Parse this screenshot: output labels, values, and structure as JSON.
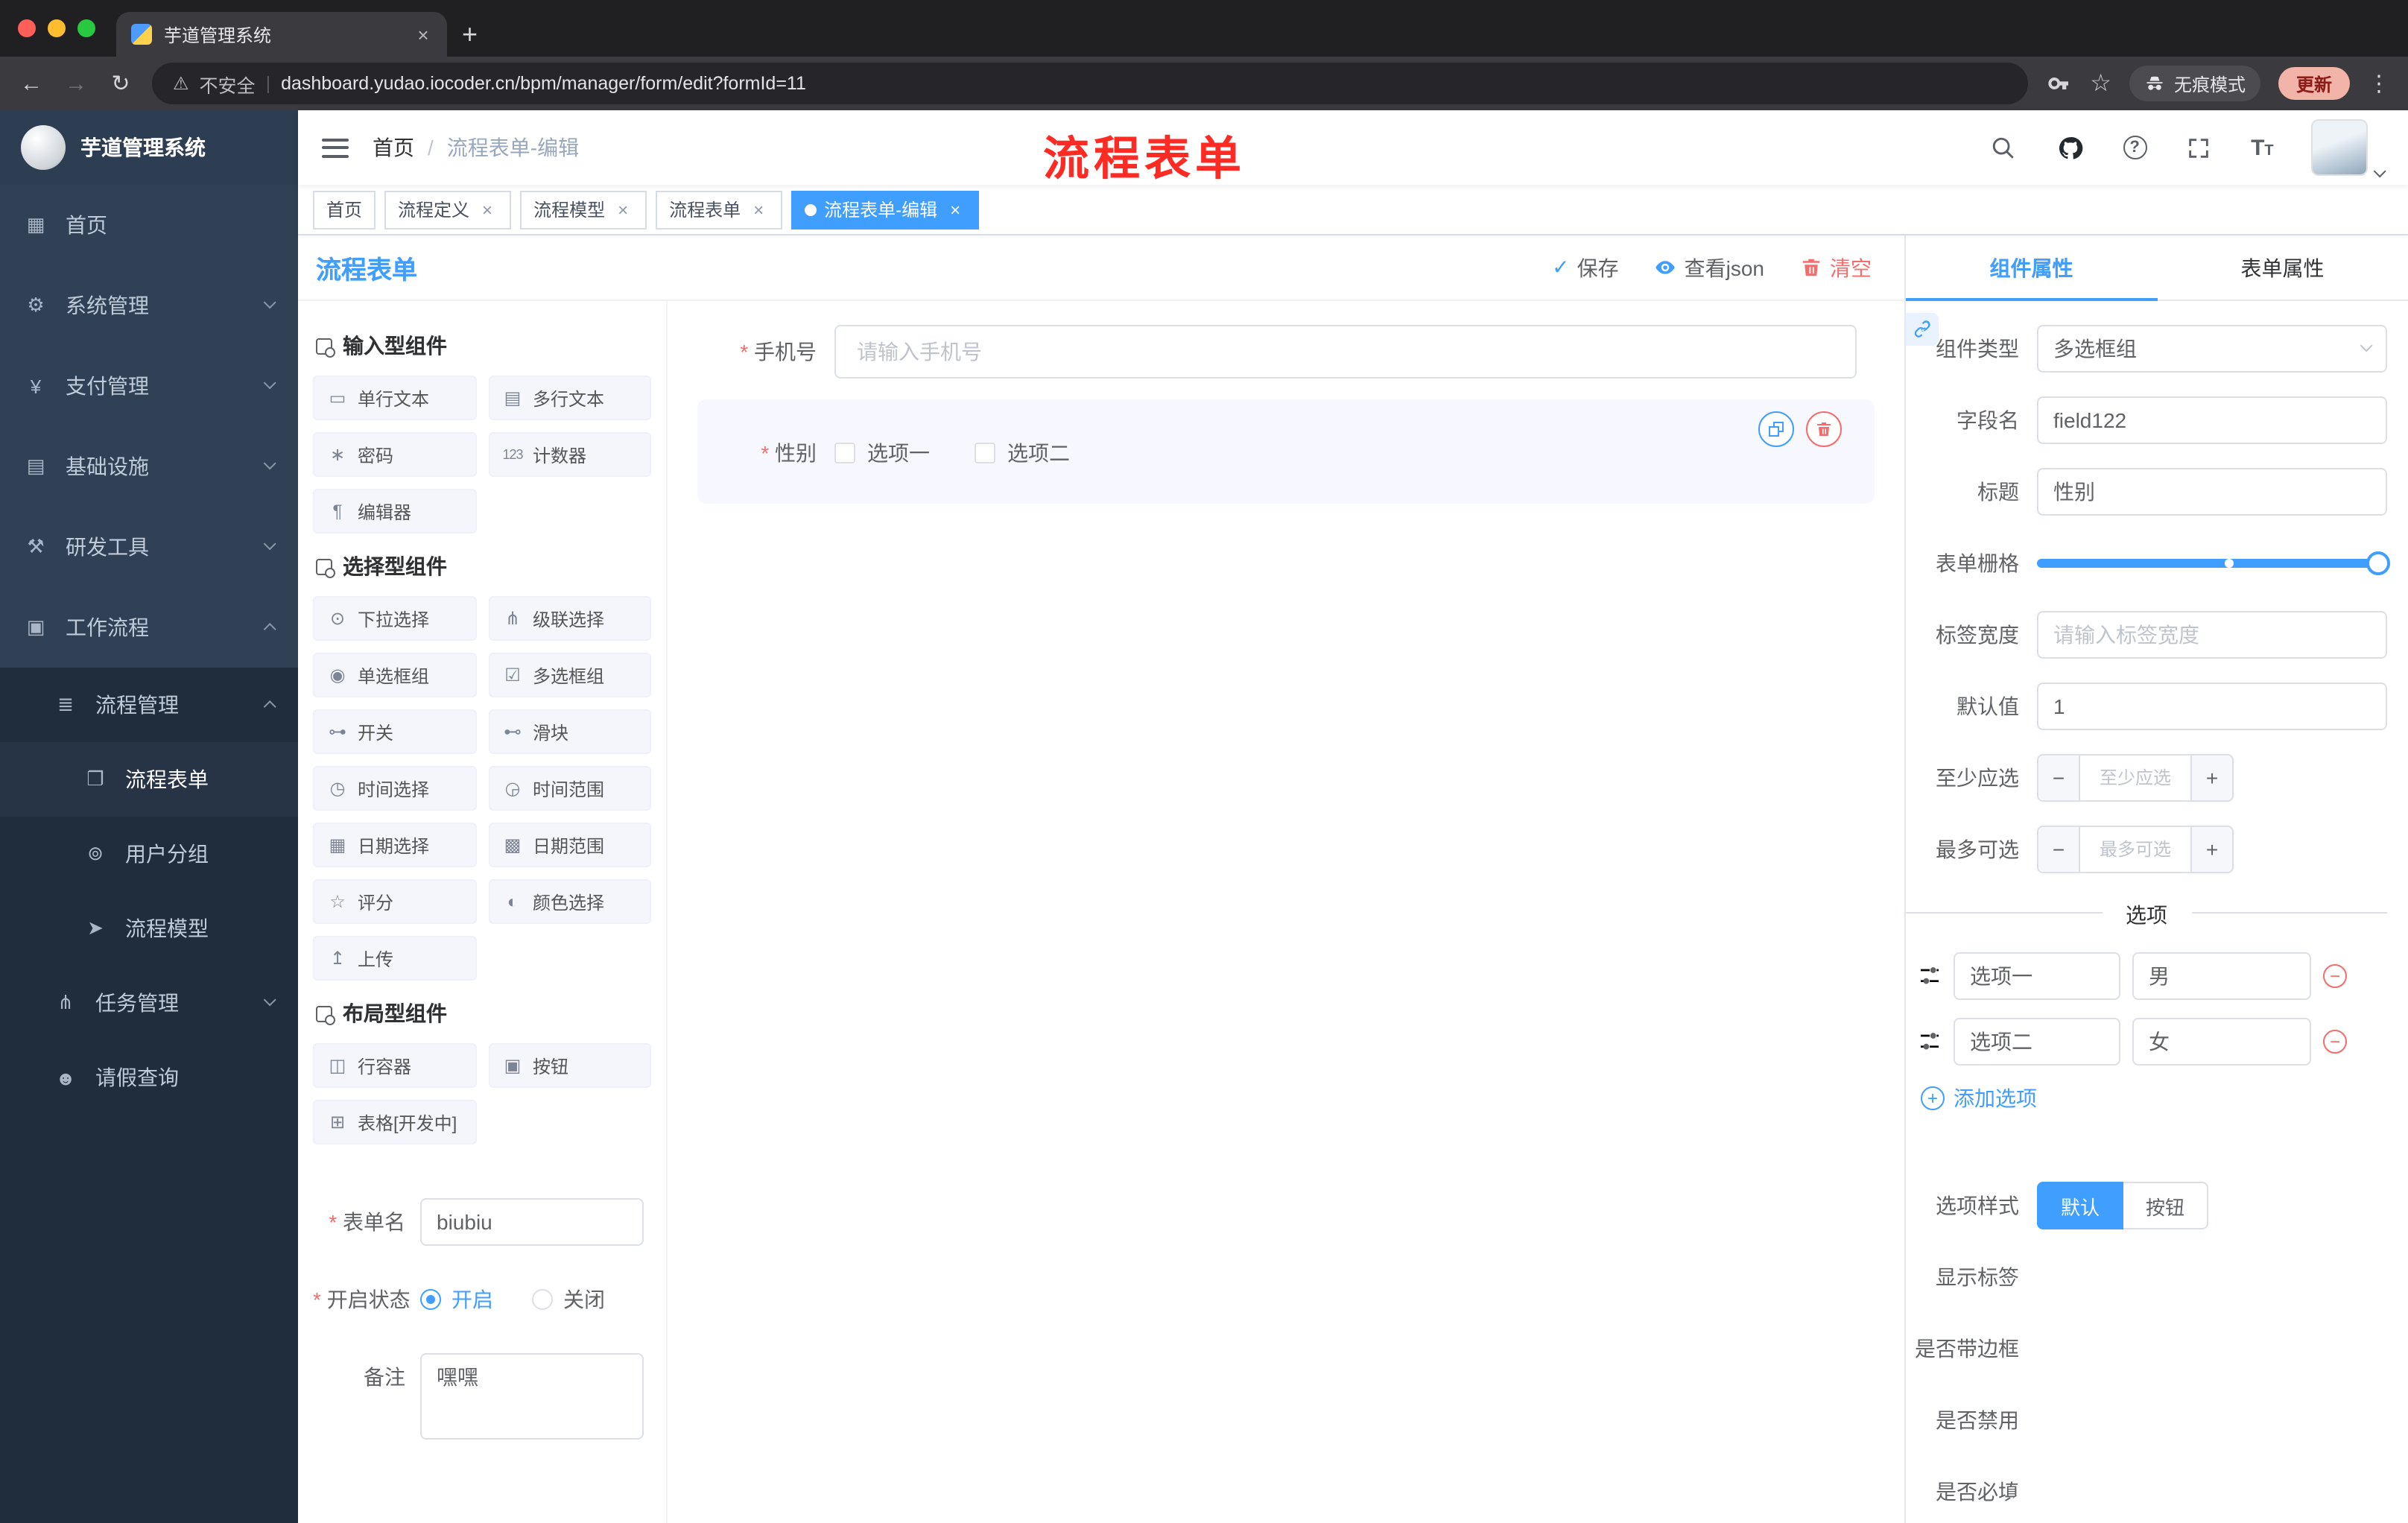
{
  "colors": {
    "primary": "#409eff",
    "danger": "#f56c6c",
    "annotation_red": "#fe2b25",
    "sidebar_bg": "#304156",
    "submenu_bg": "#1f2d3d"
  },
  "browser": {
    "tab_title": "芋道管理系统",
    "new_tab": "+",
    "security_label": "不安全",
    "url": "dashboard.yudao.iocoder.cn/bpm/manager/form/edit?formId=11",
    "incognito_label": "无痕模式",
    "update_label": "更新"
  },
  "sidebar": {
    "logo_title": "芋道管理系统",
    "menu": [
      {
        "label": "首页"
      },
      {
        "label": "系统管理"
      },
      {
        "label": "支付管理"
      },
      {
        "label": "基础设施"
      },
      {
        "label": "研发工具"
      },
      {
        "label": "工作流程"
      }
    ],
    "submenu": {
      "process_mgmt": "流程管理",
      "process_form": "流程表单",
      "user_group": "用户分组",
      "process_model": "流程模型",
      "task_mgmt": "任务管理",
      "leave_query": "请假查询"
    }
  },
  "navbar": {
    "breadcrumb": [
      "首页",
      "流程表单-编辑"
    ],
    "annotation": "流程表单"
  },
  "tags": [
    {
      "label": "首页"
    },
    {
      "label": "流程定义"
    },
    {
      "label": "流程模型"
    },
    {
      "label": "流程表单"
    },
    {
      "label": "流程表单-编辑"
    }
  ],
  "designer": {
    "title": "流程表单",
    "actions": {
      "save": "保存",
      "view_json": "查看json",
      "clear": "清空"
    },
    "groups": [
      {
        "title": "输入型组件",
        "items": [
          "单行文本",
          "多行文本",
          "密码",
          "计数器",
          "编辑器"
        ]
      },
      {
        "title": "选择型组件",
        "items": [
          "下拉选择",
          "级联选择",
          "单选框组",
          "多选框组",
          "开关",
          "滑块",
          "时间选择",
          "时间范围",
          "日期选择",
          "日期范围",
          "评分",
          "颜色选择",
          "上传"
        ]
      },
      {
        "title": "布局型组件",
        "items": [
          "行容器",
          "按钮",
          "表格[开发中]"
        ]
      }
    ],
    "meta": {
      "form_name_label": "表单名",
      "form_name_value": "biubiu",
      "status_label": "开启状态",
      "status_on": "开启",
      "status_off": "关闭",
      "remark_label": "备注",
      "remark_value": "嘿嘿"
    },
    "canvas": {
      "phone_label": "手机号",
      "phone_placeholder": "请输入手机号",
      "gender_label": "性别",
      "gender_option1": "选项一",
      "gender_option2": "选项二"
    }
  },
  "props": {
    "tab_component": "组件属性",
    "tab_form": "表单属性",
    "component_type_label": "组件类型",
    "component_type_value": "多选框组",
    "field_name_label": "字段名",
    "field_name_value": "field122",
    "title_label": "标题",
    "title_value": "性别",
    "grid_label": "表单栅格",
    "label_width_label": "标签宽度",
    "label_width_placeholder": "请输入标签宽度",
    "default_label": "默认值",
    "default_value": "1",
    "min_label": "至少应选",
    "min_placeholder": "至少应选",
    "max_label": "最多可选",
    "max_placeholder": "最多可选",
    "options_divider": "选项",
    "option1_label": "选项一",
    "option1_value": "男",
    "option2_label": "选项二",
    "option2_value": "女",
    "add_option": "添加选项",
    "option_style_label": "选项样式",
    "style_default": "默认",
    "style_button": "按钮",
    "show_label": "显示标签",
    "with_border": "是否带边框",
    "disabled": "是否禁用",
    "required": "是否必填"
  }
}
